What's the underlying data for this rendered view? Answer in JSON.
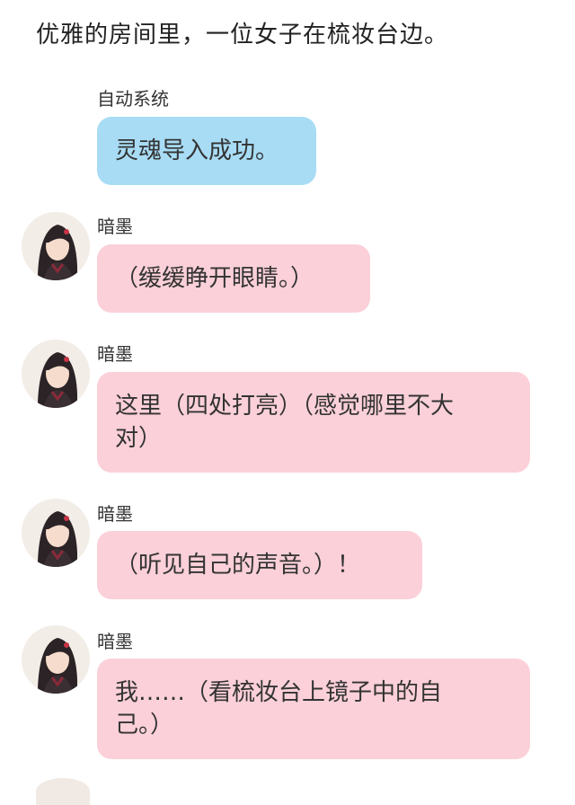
{
  "narration": "优雅的房间里，一位女子在梳妆台边。",
  "messages": [
    {
      "sender": "自动系统",
      "text": "灵魂导入成功。",
      "type": "system",
      "avatar": null
    },
    {
      "sender": "暗墨",
      "text": "（缓缓睁开眼睛。）",
      "type": "character",
      "avatar": "girl-portrait-avatar"
    },
    {
      "sender": "暗墨",
      "text_lines": [
        "这里（四处打亮）（感觉哪里不大",
        "对）"
      ],
      "type": "character",
      "avatar": "girl-portrait-avatar"
    },
    {
      "sender": "暗墨",
      "text": "（听见自己的声音。）！",
      "type": "character",
      "avatar": "girl-portrait-avatar"
    },
    {
      "sender": "暗墨",
      "text_lines": [
        "我……（看梳妆台上镜子中的自",
        "己。）"
      ],
      "type": "character",
      "avatar": "girl-portrait-avatar"
    }
  ],
  "colors": {
    "system_bubble": "#a8dcf5",
    "character_bubble": "#fbd0d9",
    "background": "#ffffff"
  }
}
